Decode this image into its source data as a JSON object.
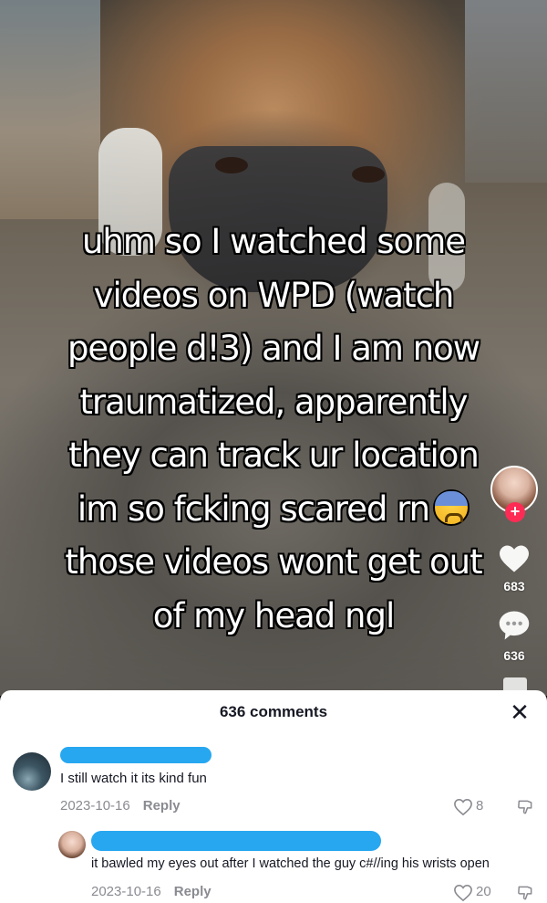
{
  "video": {
    "caption_lines": [
      "uhm so I watched some",
      "videos on WPD (watch",
      "people d!3) and I am now",
      "traumatized, apparently",
      "they can track ur location",
      "im so fcking scared rn",
      "those videos wont get out",
      "of my head ngl"
    ],
    "caption_emoji": "anxious-face-with-sweat"
  },
  "rail": {
    "like_count": "683",
    "comment_count": "636",
    "follow_symbol": "+",
    "colors": {
      "follow": "#fe2c55"
    }
  },
  "comments_sheet": {
    "title": "636 comments",
    "close_symbol": "✕",
    "comments": [
      {
        "text": "I still watch it its kind fun",
        "date": "2023-10-16",
        "reply_label": "Reply",
        "likes": "8"
      },
      {
        "text": "it bawled my eyes out after I watched the guy c#//ing his wrists open",
        "date": "2023-10-16",
        "reply_label": "Reply",
        "likes": "20"
      }
    ],
    "colors": {
      "redaction": "#27a7f0",
      "meta": "#8a8b91",
      "text": "#161823"
    }
  }
}
